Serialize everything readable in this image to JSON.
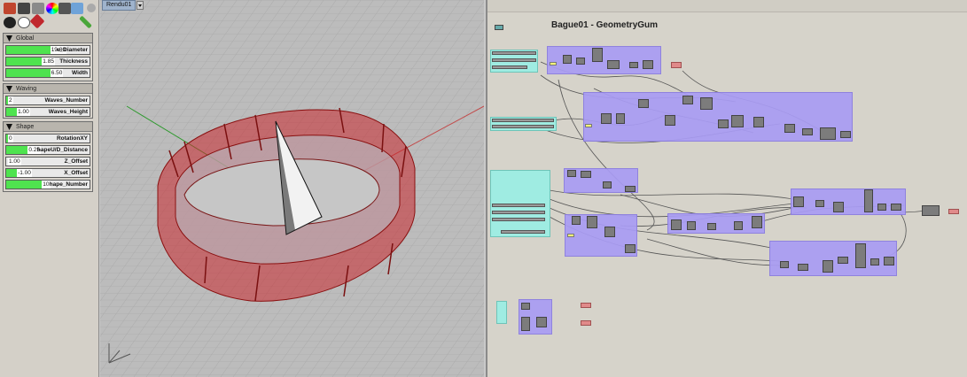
{
  "viewport": {
    "tab_label": "Rendu01"
  },
  "toolbar": {
    "icons": [
      "brush-icon",
      "camera-icon",
      "layers-icon",
      "color-wheel-icon",
      "monitor-icon",
      "label-icon",
      "settings-icon",
      "bowling-icon",
      "eye-icon",
      "gem-icon",
      "pencil-icon"
    ]
  },
  "groups": {
    "global": {
      "title": "Global",
      "sliders": [
        {
          "value": "19.80",
          "name": "e_Diameter",
          "fill": 0.55
        },
        {
          "value": "1.85",
          "name": "Thickness",
          "fill": 0.45
        },
        {
          "value": "6.50",
          "name": "Width",
          "fill": 0.55
        }
      ]
    },
    "waving": {
      "title": "Waving",
      "sliders": [
        {
          "value": "2",
          "name": "Waves_Number",
          "fill": 0.03
        },
        {
          "value": "1.00",
          "name": "Waves_Height",
          "fill": 0.15
        }
      ]
    },
    "shape": {
      "title": "Shape",
      "sliders": [
        {
          "value": "0",
          "name": "RotationXY",
          "fill": 0.03
        },
        {
          "value": "0.25",
          "name": "hapeU/D_Distance",
          "fill": 0.28
        },
        {
          "value": "1.00",
          "name": "Z_Offset",
          "fill": 0.0
        },
        {
          "value": "-1.00",
          "name": "X_Offset",
          "fill": 0.15
        },
        {
          "value": "10",
          "name": "hape_Number",
          "fill": 0.45
        }
      ]
    }
  },
  "canvas": {
    "title": "Bague01 - GeometryGum"
  },
  "colors": {
    "group_purple": "#a99cf4",
    "input_cyan": "#9fece2",
    "output_red": "#e08a8a",
    "slider_green": "#4fe34f",
    "ring_red": "#c8262b"
  }
}
